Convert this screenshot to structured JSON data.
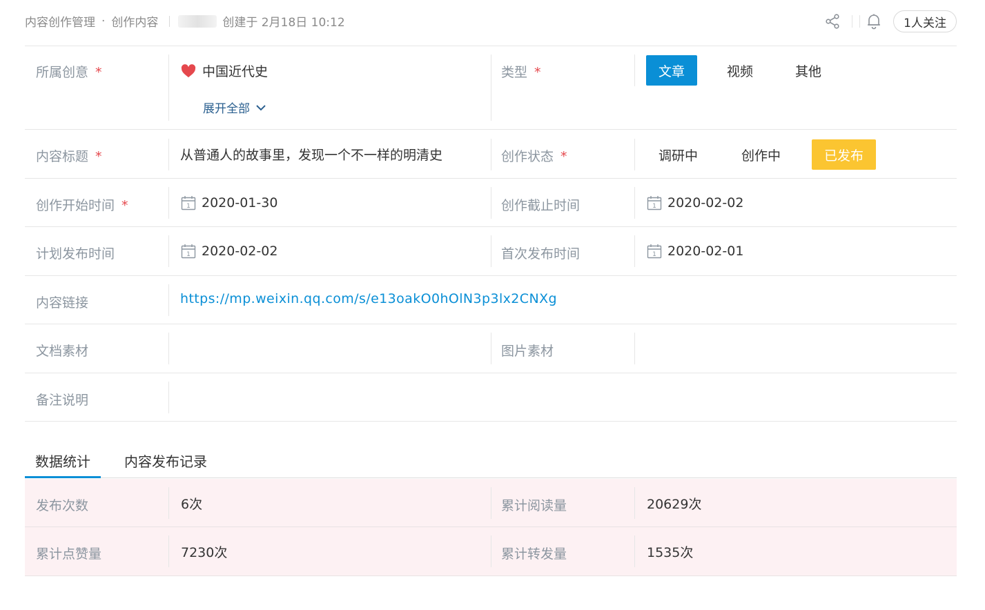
{
  "header": {
    "breadcrumb_root": "内容创作管理",
    "breadcrumb_sep": "·",
    "breadcrumb_current": "创作内容",
    "created_text": "创建于 2月18日 10:12",
    "follow_label": "1人关注",
    "icons": [
      "share-icon",
      "bell-icon"
    ]
  },
  "form": {
    "idea": {
      "label": "所属创意",
      "required": "*",
      "value": "中国近代史",
      "expand_label": "展开全部",
      "icon": "heart-icon",
      "icon_color": "#e5484d"
    },
    "type": {
      "label": "类型",
      "required": "*",
      "options": [
        "文章",
        "视频",
        "其他"
      ],
      "selected": "文章"
    },
    "title": {
      "label": "内容标题",
      "required": "*",
      "value": "从普通人的故事里，发现一个不一样的明清史"
    },
    "status": {
      "label": "创作状态",
      "required": "*",
      "options": [
        "调研中",
        "创作中",
        "已发布"
      ],
      "selected": "已发布"
    },
    "start_date": {
      "label": "创作开始时间",
      "required": "*",
      "value": "2020-01-30"
    },
    "deadline": {
      "label": "创作截止时间",
      "value": "2020-02-02"
    },
    "plan_publish": {
      "label": "计划发布时间",
      "value": "2020-02-02"
    },
    "first_publish": {
      "label": "首次发布时间",
      "value": "2020-02-01"
    },
    "link": {
      "label": "内容链接",
      "value": "https://mp.weixin.qq.com/s/e13oakO0hOlN3p3lx2CNXg"
    },
    "doc_material": {
      "label": "文档素材",
      "value": ""
    },
    "img_material": {
      "label": "图片素材",
      "value": ""
    },
    "remark": {
      "label": "备注说明",
      "value": ""
    }
  },
  "tabs": [
    {
      "label": "数据统计",
      "active": true
    },
    {
      "label": "内容发布记录",
      "active": false
    }
  ],
  "stats": {
    "publish_count": {
      "label": "发布次数",
      "value": "6次"
    },
    "read_total": {
      "label": "累计阅读量",
      "value": "20629次"
    },
    "like_total": {
      "label": "累计点赞量",
      "value": "7230次"
    },
    "share_total": {
      "label": "累计转发量",
      "value": "1535次"
    }
  },
  "colors": {
    "accent": "#0a8fd6",
    "published": "#fbc531",
    "required": "#e5484d",
    "stats_bg": "#fdf1f3"
  }
}
